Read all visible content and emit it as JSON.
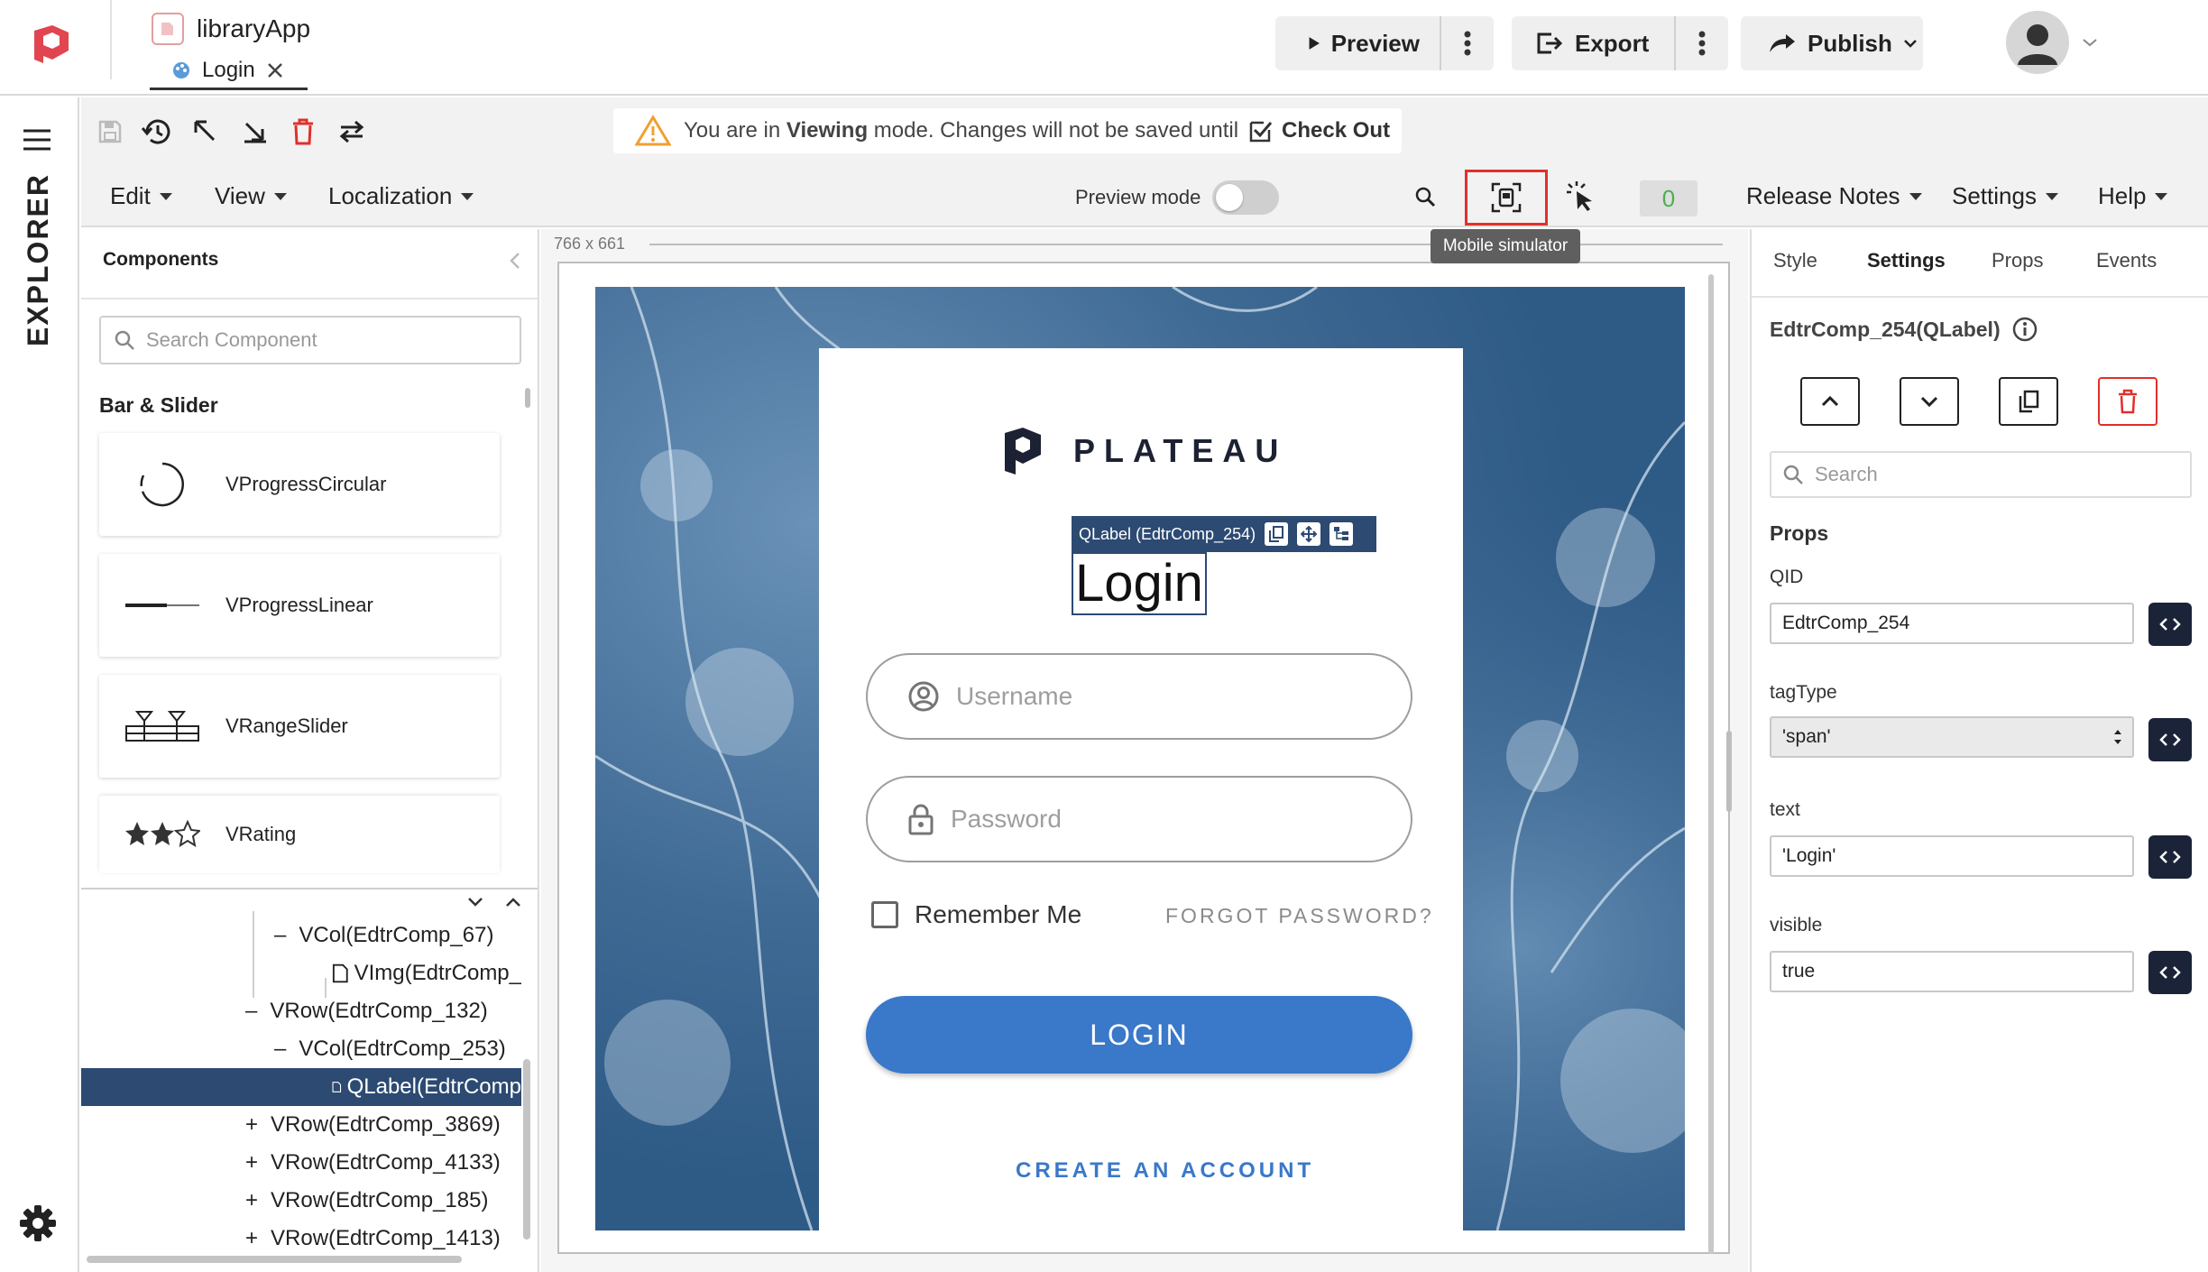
{
  "app": {
    "name": "libraryApp",
    "page_tab": "Login"
  },
  "header": {
    "preview_label": "Preview",
    "export_label": "Export",
    "publish_label": "Publish"
  },
  "notice": {
    "prefix": "You are in ",
    "mode": "Viewing",
    "suffix": " mode. Changes will not be saved until",
    "action": "Check Out"
  },
  "menubar": {
    "edit": "Edit",
    "view": "View",
    "localization": "Localization",
    "preview_mode": "Preview mode",
    "counter": "0",
    "release_notes": "Release Notes",
    "settings": "Settings",
    "help": "Help",
    "tooltip": "Mobile simulator"
  },
  "explorer": {
    "label": "EXPLORER"
  },
  "components_panel": {
    "title": "Components",
    "search_placeholder": "Search Component",
    "section": "Bar & Slider",
    "items": [
      {
        "label": "VProgressCircular",
        "icon": "progress-circular-icon"
      },
      {
        "label": "VProgressLinear",
        "icon": "progress-linear-icon"
      },
      {
        "label": "VRangeSlider",
        "icon": "range-slider-icon"
      },
      {
        "label": "VRating",
        "icon": "rating-icon"
      }
    ]
  },
  "tree": {
    "rows": [
      {
        "prefix": "–",
        "label": "VCol(EdtrComp_67)"
      },
      {
        "prefix": "",
        "label": "VImg(EdtrComp_"
      },
      {
        "prefix": "–",
        "label": "VRow(EdtrComp_132)"
      },
      {
        "prefix": "–",
        "label": "VCol(EdtrComp_253)"
      },
      {
        "prefix": "",
        "label": "QLabel(EdtrComp"
      },
      {
        "prefix": "+",
        "label": "VRow(EdtrComp_3869)"
      },
      {
        "prefix": "+",
        "label": "VRow(EdtrComp_4133)"
      },
      {
        "prefix": "+",
        "label": "VRow(EdtrComp_185)"
      },
      {
        "prefix": "+",
        "label": "VRow(EdtrComp_1413)"
      }
    ]
  },
  "canvas": {
    "size_label": "766 x 661",
    "selection_label": "QLabel (EdtrComp_254)"
  },
  "login_form": {
    "brand": "PLATEAU",
    "title": "Login",
    "username_placeholder": "Username",
    "password_placeholder": "Password",
    "remember_me": "Remember Me",
    "forgot_password": "FORGOT PASSWORD?",
    "login_button": "LOGIN",
    "create_account": "CREATE AN ACCOUNT",
    "accent_color": "#3a78c9"
  },
  "properties": {
    "tabs": [
      "Style",
      "Settings",
      "Props",
      "Events"
    ],
    "active_tab": "Settings",
    "component_title": "EdtrComp_254(QLabel)",
    "search_placeholder": "Search",
    "section": "Props",
    "fields": [
      {
        "label": "QID",
        "value": "EdtrComp_254"
      },
      {
        "label": "tagType",
        "value": "'span'"
      },
      {
        "label": "text",
        "value": "'Login'"
      },
      {
        "label": "visible",
        "value": "true"
      }
    ]
  }
}
